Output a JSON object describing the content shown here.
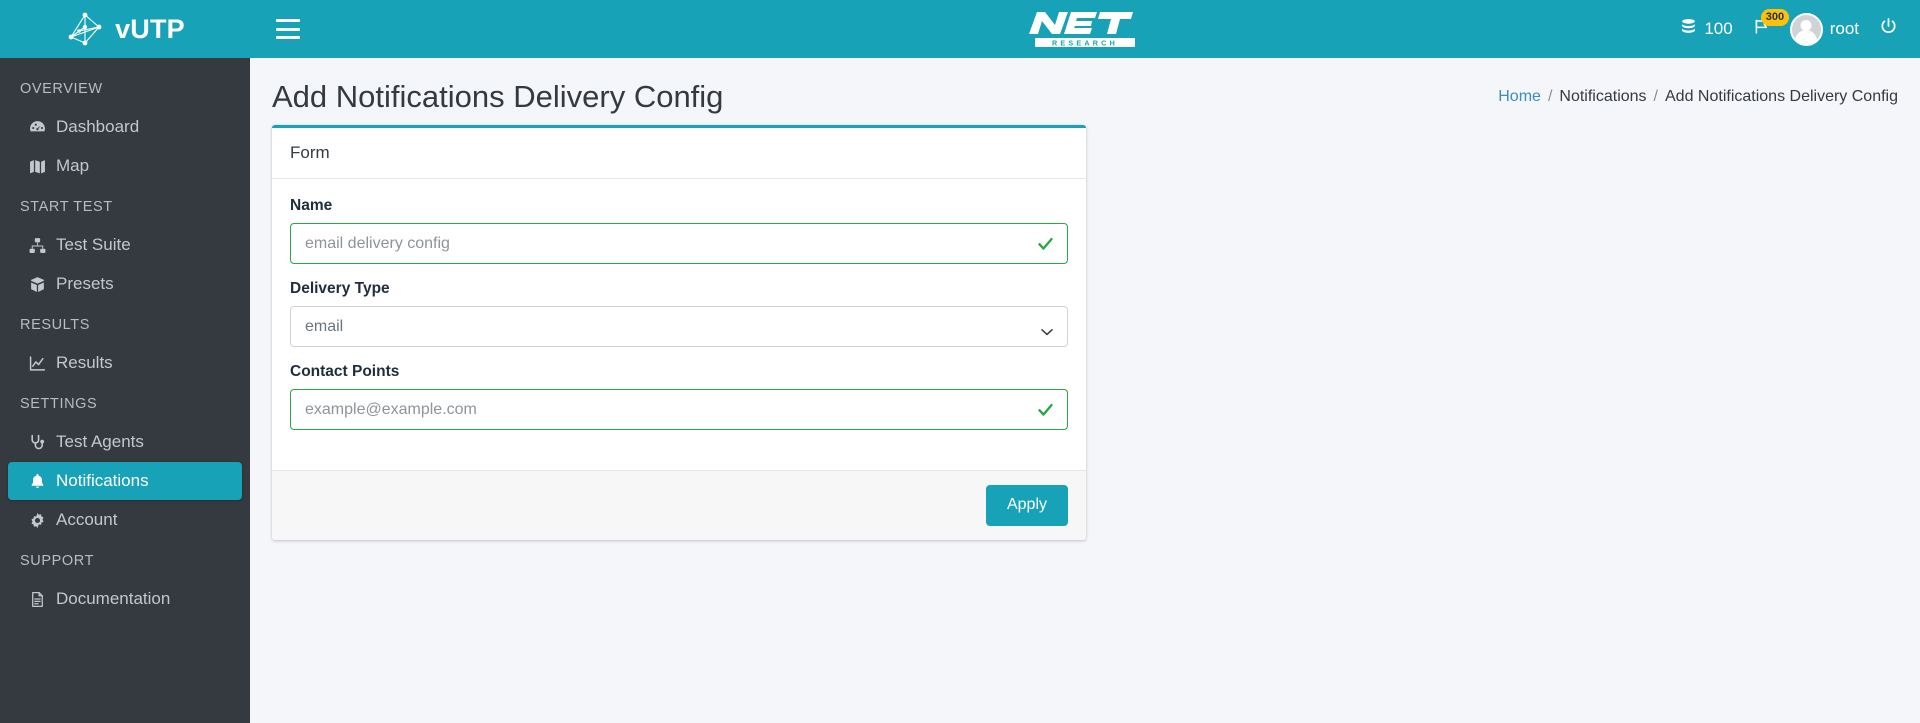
{
  "brand": {
    "name": "vUTP",
    "logo_icon": "network-graph-icon"
  },
  "sidebar": {
    "sections": [
      {
        "header": "OVERVIEW",
        "items": [
          {
            "label": "Dashboard",
            "icon": "dashboard-icon",
            "active": false
          },
          {
            "label": "Map",
            "icon": "map-icon",
            "active": false
          }
        ]
      },
      {
        "header": "START TEST",
        "items": [
          {
            "label": "Test Suite",
            "icon": "sitemap-icon",
            "active": false
          },
          {
            "label": "Presets",
            "icon": "box-icon",
            "active": false
          }
        ]
      },
      {
        "header": "RESULTS",
        "items": [
          {
            "label": "Results",
            "icon": "chart-line-icon",
            "active": false
          }
        ]
      },
      {
        "header": "SETTINGS",
        "items": [
          {
            "label": "Test Agents",
            "icon": "stethoscope-icon",
            "active": false
          },
          {
            "label": "Notifications",
            "icon": "bell-icon",
            "active": true
          },
          {
            "label": "Account",
            "icon": "gear-icon",
            "active": false
          }
        ]
      },
      {
        "header": "SUPPORT",
        "items": [
          {
            "label": "Documentation",
            "icon": "file-text-icon",
            "active": false
          }
        ]
      }
    ]
  },
  "topbar": {
    "menu_toggle_icon": "hamburger-icon",
    "logo_text": "NET RESEARCH",
    "logo_title": "NET",
    "logo_subtitle": "RESEARCH",
    "credits_icon": "coins-icon",
    "credits_value": "100",
    "flag_icon": "flag-icon",
    "flag_badge": "300",
    "avatar_icon": "user-avatar-icon",
    "username": "root",
    "logout_icon": "power-icon"
  },
  "page": {
    "title": "Add Notifications Delivery Config",
    "breadcrumb": [
      {
        "label": "Home",
        "link": true
      },
      {
        "label": "Notifications",
        "link": false
      },
      {
        "label": "Add Notifications Delivery Config",
        "link": false
      }
    ],
    "breadcrumb_separator": "/"
  },
  "form": {
    "card_title": "Form",
    "fields": [
      {
        "label": "Name",
        "type": "text",
        "value": "",
        "placeholder": "email delivery config",
        "state": "valid",
        "valid_icon": "check-icon"
      },
      {
        "label": "Delivery Type",
        "type": "select",
        "value": "email",
        "options": [
          "email"
        ],
        "caret_icon": "chevron-down-icon"
      },
      {
        "label": "Contact Points",
        "type": "text",
        "value": "",
        "placeholder": "example@example.com",
        "state": "valid",
        "valid_icon": "check-icon"
      }
    ],
    "apply_label": "Apply"
  },
  "colors": {
    "accent": "#17a2b8",
    "sidebar_bg": "#343a40",
    "valid_green": "#28a745",
    "badge_yellow": "#ffc107",
    "link_blue": "#3c8dbc"
  }
}
